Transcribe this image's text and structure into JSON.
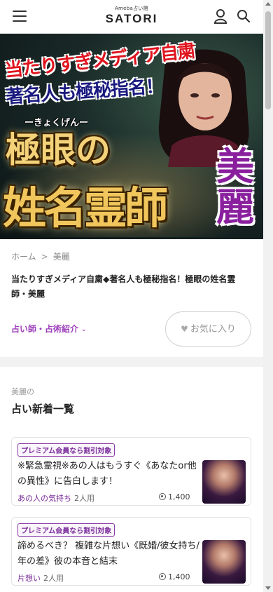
{
  "header": {
    "logo_sub": "Ameba占い館",
    "logo_main": "SATORI"
  },
  "hero": {
    "tagline1": "当たりすぎメディア自粛",
    "tagline2": "著名人も極秘指名！",
    "ruby": "ーきょくげんー",
    "headline1": "極眼の",
    "headline2": "姓名霊師",
    "name": "美麗"
  },
  "breadcrumb": {
    "home": "ホーム",
    "current": "美麗"
  },
  "page_title": "当たりすぎメディア自粛◆著名人も極秘指名！極眼の姓名霊師・美麗",
  "intro_link": "占い師・占術紹介",
  "fav_button": "お気に入り",
  "section": {
    "sub": "美麗の",
    "title": "占い新着一覧"
  },
  "cards": [
    {
      "badge": "プレミアム会員なら割引対象",
      "title": "※緊急霊視※あの人はもうすぐ《あなたor他の異性》に告白します！",
      "category": "あの人の気持ち",
      "users": "2人用",
      "price": "1,400"
    },
    {
      "badge": "プレミアム会員なら割引対象",
      "title": "諦めるべき？ 複雑な片想い《既婚/彼女持ち/年の差》彼の本音と結末",
      "category": "片想い",
      "users": "2人用",
      "price": "1,400"
    }
  ],
  "colors": {
    "accent": "#9c3fb9",
    "badge": "#7a2b9b"
  }
}
